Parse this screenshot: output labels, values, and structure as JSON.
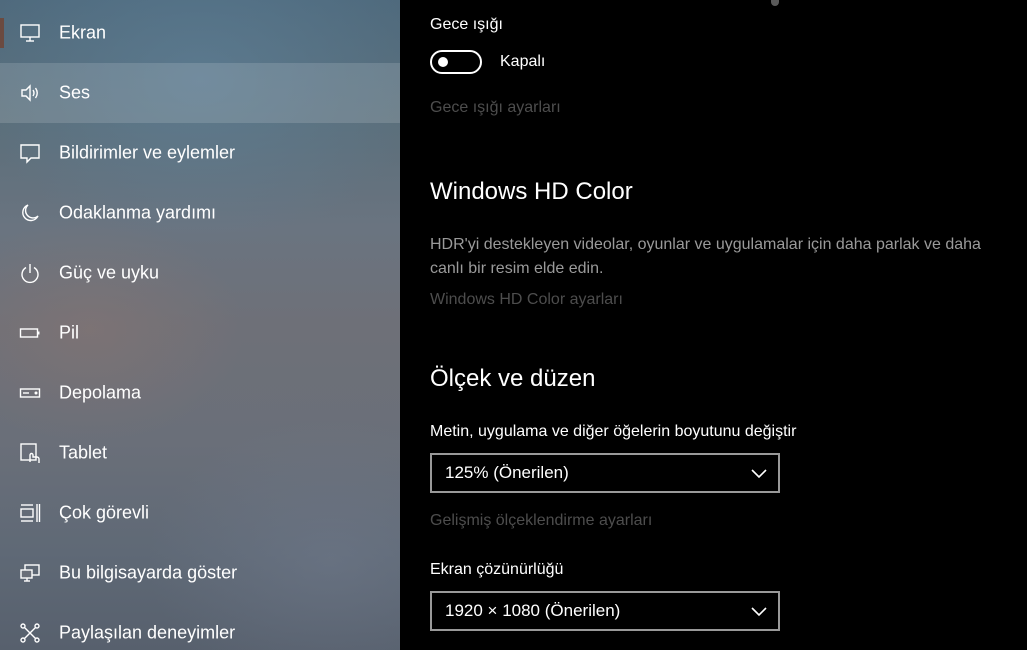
{
  "sidebar": {
    "items": [
      {
        "label": "Ekran",
        "icon": "display-icon"
      },
      {
        "label": "Ses",
        "icon": "speaker-icon"
      },
      {
        "label": "Bildirimler ve eylemler",
        "icon": "notification-icon"
      },
      {
        "label": "Odaklanma yardımı",
        "icon": "moon-icon"
      },
      {
        "label": "Güç ve uyku",
        "icon": "power-icon"
      },
      {
        "label": "Pil",
        "icon": "battery-icon"
      },
      {
        "label": "Depolama",
        "icon": "storage-icon"
      },
      {
        "label": "Tablet",
        "icon": "tablet-icon"
      },
      {
        "label": "Çok görevli",
        "icon": "multitasking-icon"
      },
      {
        "label": "Bu bilgisayarda göster",
        "icon": "project-icon"
      },
      {
        "label": "Paylaşılan deneyimler",
        "icon": "shared-icon"
      }
    ],
    "selected": "Ses"
  },
  "night_light": {
    "title": "Gece ışığı",
    "toggle_state": "Kapalı",
    "settings_link": "Gece ışığı ayarları"
  },
  "hd_color": {
    "title": "Windows HD Color",
    "description": "HDR'yi destekleyen videolar, oyunlar ve uygulamalar için daha parlak ve daha canlı bir resim elde edin.",
    "settings_link": "Windows HD Color ayarları"
  },
  "scale_layout": {
    "title": "Ölçek ve düzen",
    "scale_label": "Metin, uygulama ve diğer öğelerin boyutunu değiştir",
    "scale_value": "125% (Önerilen)",
    "advanced_link": "Gelişmiş ölçeklendirme ayarları",
    "resolution_label": "Ekran çözünürlüğü",
    "resolution_value": "1920 × 1080 (Önerilen)"
  },
  "colors": {
    "accent": "#6b4a40",
    "link_disabled": "#4d4d4d"
  }
}
